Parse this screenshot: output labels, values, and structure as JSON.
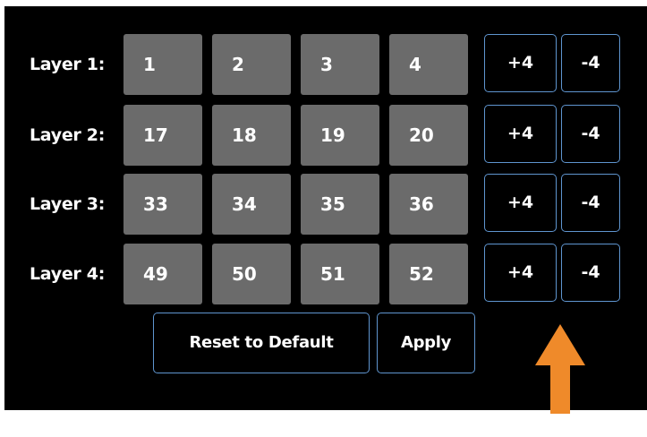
{
  "layers": [
    {
      "label": "Layer 1:",
      "slots": [
        "1",
        "2",
        "3",
        "4"
      ],
      "plus": "+4",
      "minus": "-4"
    },
    {
      "label": "Layer 2:",
      "slots": [
        "17",
        "18",
        "19",
        "20"
      ],
      "plus": "+4",
      "minus": "-4"
    },
    {
      "label": "Layer 3:",
      "slots": [
        "33",
        "34",
        "35",
        "36"
      ],
      "plus": "+4",
      "minus": "-4"
    },
    {
      "label": "Layer 4:",
      "slots": [
        "49",
        "50",
        "51",
        "52"
      ],
      "plus": "+4",
      "minus": "-4"
    }
  ],
  "actions": {
    "reset_label": "Reset to Default",
    "apply_label": "Apply"
  },
  "colors": {
    "panel_bg": "#000000",
    "slot_bg": "#6b6b6b",
    "button_border": "#5f95cf",
    "arrow": "#ef8a2a"
  },
  "icons": {
    "annotation": "up-arrow-icon"
  }
}
